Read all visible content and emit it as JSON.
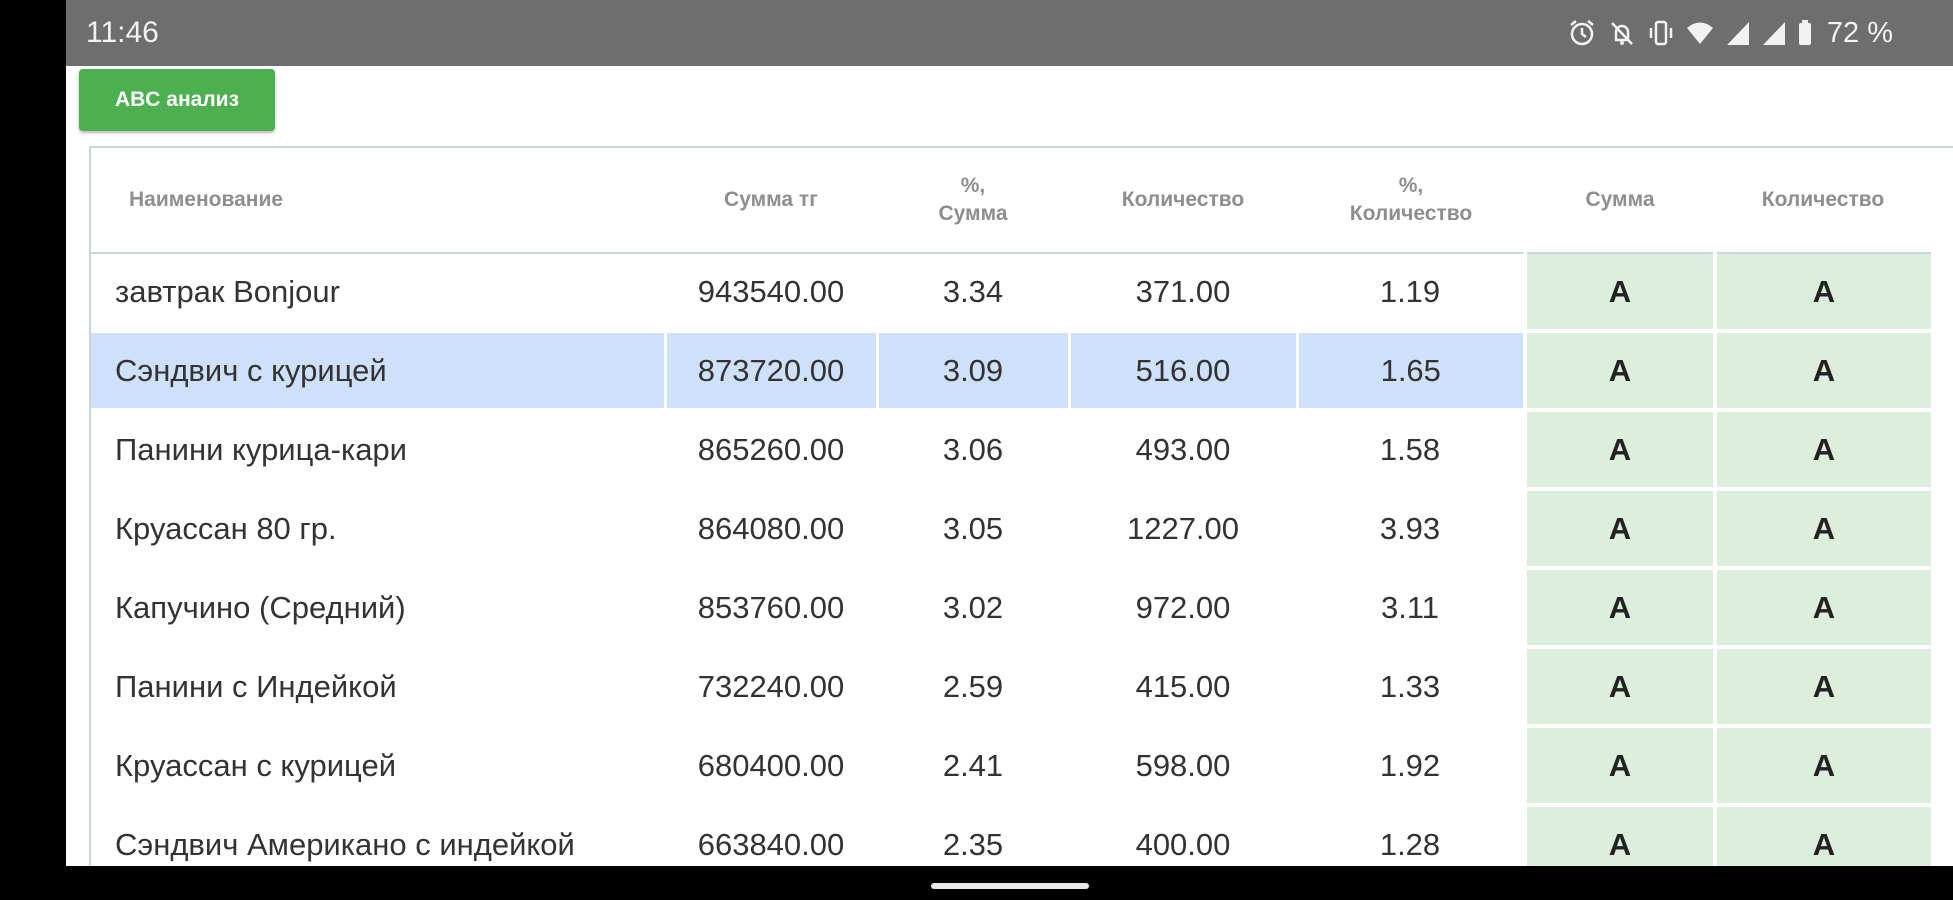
{
  "status_bar": {
    "time": "11:46",
    "battery_percent": "72 %",
    "icons": [
      "alarm-icon",
      "notifications-off-icon",
      "vibrate-icon",
      "wifi-icon",
      "signal-icon",
      "signal-icon",
      "battery-icon"
    ]
  },
  "toolbar": {
    "abc_button_label": "ABC анализ"
  },
  "table": {
    "headers": {
      "name": "Наименование",
      "sum": "Сумма тг",
      "pct_sum_line1": "%,",
      "pct_sum_line2": "Сумма",
      "qty": "Количество",
      "pct_qty_line1": "%,",
      "pct_qty_line2": "Количество",
      "class_sum": "Сумма",
      "class_qty": "Количество"
    },
    "rows": [
      {
        "name": "завтрак Bonjour",
        "sum": "943540.00",
        "pct_sum": "3.34",
        "qty": "371.00",
        "pct_qty": "1.19",
        "class_sum": "A",
        "class_qty": "A"
      },
      {
        "name": "Сэндвич с курицей",
        "sum": "873720.00",
        "pct_sum": "3.09",
        "qty": "516.00",
        "pct_qty": "1.65",
        "class_sum": "A",
        "class_qty": "A"
      },
      {
        "name": "Панини курица-кари",
        "sum": "865260.00",
        "pct_sum": "3.06",
        "qty": "493.00",
        "pct_qty": "1.58",
        "class_sum": "A",
        "class_qty": "A"
      },
      {
        "name": "Круассан 80 гр.",
        "sum": "864080.00",
        "pct_sum": "3.05",
        "qty": "1227.00",
        "pct_qty": "3.93",
        "class_sum": "A",
        "class_qty": "A"
      },
      {
        "name": "Капучино (Средний)",
        "sum": "853760.00",
        "pct_sum": "3.02",
        "qty": "972.00",
        "pct_qty": "3.11",
        "class_sum": "A",
        "class_qty": "A"
      },
      {
        "name": "Панини с Индейкой",
        "sum": "732240.00",
        "pct_sum": "2.59",
        "qty": "415.00",
        "pct_qty": "1.33",
        "class_sum": "A",
        "class_qty": "A"
      },
      {
        "name": "Круассан с курицей",
        "sum": "680400.00",
        "pct_sum": "2.41",
        "qty": "598.00",
        "pct_qty": "1.92",
        "class_sum": "A",
        "class_qty": "A"
      },
      {
        "name": "Сэндвич Американо с индейкой",
        "sum": "663840.00",
        "pct_sum": "2.35",
        "qty": "400.00",
        "pct_qty": "1.28",
        "class_sum": "A",
        "class_qty": "A"
      }
    ]
  },
  "colors": {
    "status_bar": "#6e6e6e",
    "button_green": "#4caf50",
    "class_cell_green": "#dcefdc",
    "selected_row_blue": "#cfe0fb"
  }
}
